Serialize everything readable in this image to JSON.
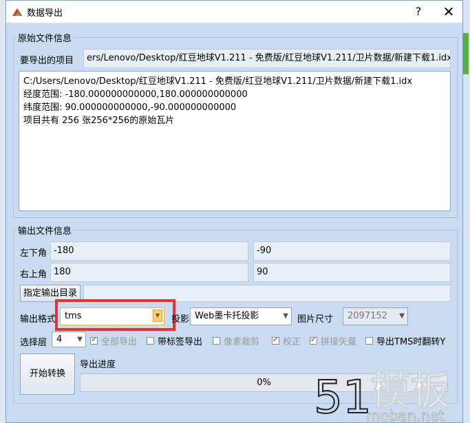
{
  "window": {
    "title": "数据导出",
    "help": "?",
    "close": "✕"
  },
  "source": {
    "legend": "原始文件信息",
    "project_label": "要导出的项目",
    "project_path": "ers/Lenovo/Desktop/红豆地球V1.211 - 免费版/红豆地球V1.211/卫片数据/新建下载1.idx",
    "info_lines": [
      "C:/Users/Lenovo/Desktop/红豆地球V1.211 - 免费版/红豆地球V1.211/卫片数据/新建下载1.idx",
      "经度范围: -180.000000000000,180.000000000000",
      "纬度范围: 90.000000000000,-90.000000000000",
      "项目共有 256 张256*256的原始瓦片"
    ]
  },
  "output": {
    "legend": "输出文件信息",
    "lower_left_label": "左下角",
    "lower_left_x": "-180",
    "lower_left_y": "-90",
    "upper_right_label": "右上角",
    "upper_right_x": "180",
    "upper_right_y": "90",
    "dir_button": "指定输出目录",
    "dir_value": "",
    "format_label": "输出格式",
    "format_value": "tms",
    "projection_label": "投影",
    "projection_value": "Web墨卡托投影",
    "size_label": "图片尺寸",
    "size_value": "2097152",
    "level_label": "选择层",
    "level_value": "4",
    "checkboxes": [
      {
        "label": "全部导出",
        "checked": true,
        "disabled": true
      },
      {
        "label": "带标签导出",
        "checked": false,
        "disabled": false
      },
      {
        "label": "像素裁剪",
        "checked": false,
        "disabled": true
      },
      {
        "label": "校正",
        "checked": true,
        "disabled": true
      },
      {
        "label": "拼接矢量",
        "checked": true,
        "disabled": true
      },
      {
        "label": "导出TMS时翻转Y",
        "checked": false,
        "disabled": false
      }
    ],
    "start_button": "开始转换",
    "progress_label": "导出进度",
    "progress_text": "0%",
    "progress_fraction": 0
  },
  "watermark": {
    "number": "51",
    "brand": "模板",
    "site": "moban.net"
  },
  "colors": {
    "dialog_bg": "#c9dcf1",
    "highlight": "#e8322f",
    "accent": "#f7d36a"
  }
}
